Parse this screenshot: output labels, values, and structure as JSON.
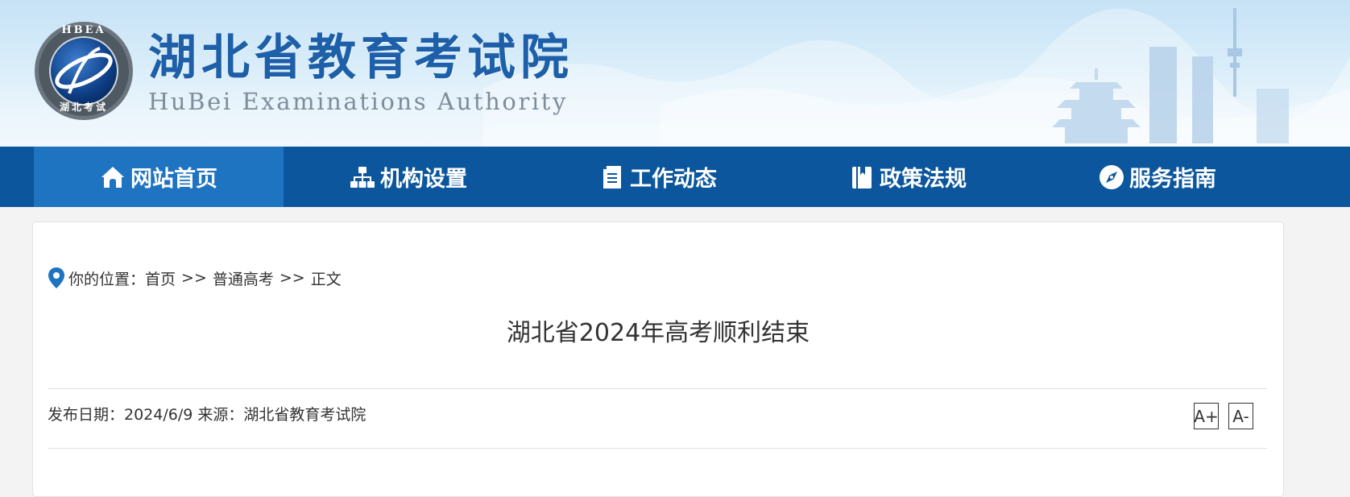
{
  "header": {
    "logo_text": "HBEA",
    "logo_bottom_text": "湖北考试",
    "title": "湖北省教育考试院",
    "subtitle": "HuBei Examinations Authority"
  },
  "nav": {
    "items": [
      {
        "label": "网站首页",
        "icon": "home-icon",
        "active": true
      },
      {
        "label": "机构设置",
        "icon": "org-chart-icon",
        "active": false
      },
      {
        "label": "工作动态",
        "icon": "document-icon",
        "active": false
      },
      {
        "label": "政策法规",
        "icon": "book-icon",
        "active": false
      },
      {
        "label": "服务指南",
        "icon": "compass-icon",
        "active": false
      }
    ]
  },
  "breadcrumb": {
    "icon": "location-pin-icon",
    "prefix": "你的位置：",
    "items": [
      "首页",
      "普通高考",
      "正文"
    ],
    "separator": ">>"
  },
  "article": {
    "title": "湖北省2024年高考顺利结束",
    "meta": "发布日期：2024/6/9 来源：湖北省教育考试院",
    "font_increase": "A+",
    "font_decrease": "A-"
  },
  "colors": {
    "nav_bg": "#0b569c",
    "nav_active": "#1f74c1",
    "title_blue": "#1d5fa8",
    "page_bg": "#f3f3f3"
  }
}
